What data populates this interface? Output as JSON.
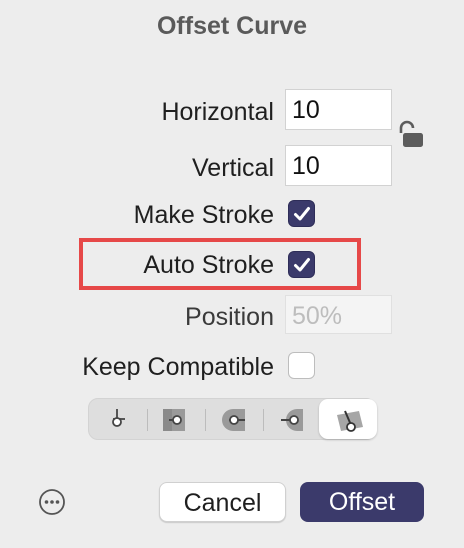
{
  "dialog": {
    "title": "Offset Curve"
  },
  "fields": {
    "horizontal": {
      "label": "Horizontal",
      "value": "10"
    },
    "vertical": {
      "label": "Vertical",
      "value": "10"
    },
    "position": {
      "label": "Position",
      "value": "50%"
    }
  },
  "checkboxes": {
    "make_stroke": {
      "label": "Make Stroke",
      "checked": true
    },
    "auto_stroke": {
      "label": "Auto Stroke",
      "checked": true
    },
    "keep_compatible": {
      "label": "Keep Compatible",
      "checked": false
    }
  },
  "cap_styles": {
    "options": [
      "butt-cap",
      "square-cap",
      "round-cap",
      "round-inset-cap",
      "angled-cap"
    ],
    "selected": "angled-cap"
  },
  "buttons": {
    "cancel": "Cancel",
    "offset": "Offset"
  },
  "colors": {
    "accent": "#3b3a6b",
    "highlight": "#e64848",
    "background": "#ededed"
  },
  "icons": {
    "lock": "lock-open-icon",
    "more": "more-options-icon"
  }
}
